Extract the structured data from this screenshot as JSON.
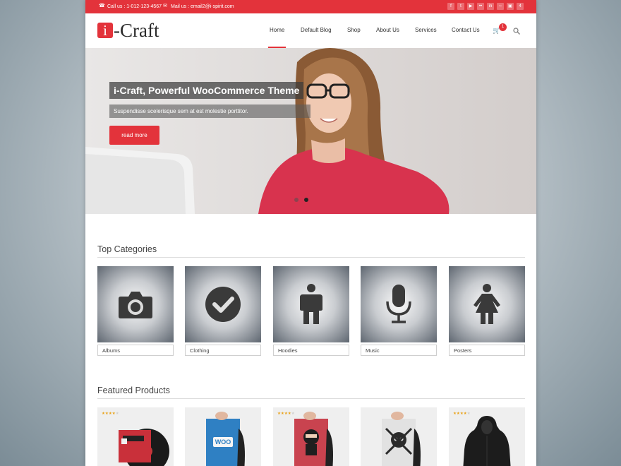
{
  "topbar": {
    "call": "Call us : 1-012-123-4567",
    "mail": "Mail us : email2@i-spirit.com",
    "social_icons": [
      "facebook-icon",
      "twitter-icon",
      "youtube-icon",
      "flickr-icon",
      "linkedin-icon",
      "rss-icon",
      "instagram-icon",
      "foursquare-icon"
    ]
  },
  "header": {
    "logo_badge": "i",
    "logo_rest": "-Craft",
    "nav": [
      "Home",
      "Default Blog",
      "Shop",
      "About Us",
      "Services",
      "Contact Us"
    ],
    "cart_count": "1"
  },
  "hero": {
    "title": "i-Craft, Powerful WooCommerce Theme",
    "subtitle": "Suspendisse scelerisque sem at est molestie porttitor.",
    "button": "read more",
    "slides": 2,
    "active_slide": 2
  },
  "categories": {
    "title": "Top Categories",
    "items": [
      {
        "label": "Albums",
        "icon": "camera-icon"
      },
      {
        "label": "Clothing",
        "icon": "checkmark-icon"
      },
      {
        "label": "Hoodies",
        "icon": "man-icon"
      },
      {
        "label": "Music",
        "icon": "microphone-icon"
      },
      {
        "label": "Posters",
        "icon": "woman-icon"
      }
    ]
  },
  "products": {
    "title": "Featured Products",
    "items": [
      {
        "image": "vinyl-album",
        "rating": 4
      },
      {
        "image": "woo-poster",
        "rating": null
      },
      {
        "image": "ninja-poster",
        "rating": 4
      },
      {
        "image": "skull-poster",
        "rating": null
      },
      {
        "image": "black-hoodie",
        "rating": 4
      }
    ]
  },
  "colors": {
    "accent": "#e3333b",
    "text": "#333333"
  }
}
